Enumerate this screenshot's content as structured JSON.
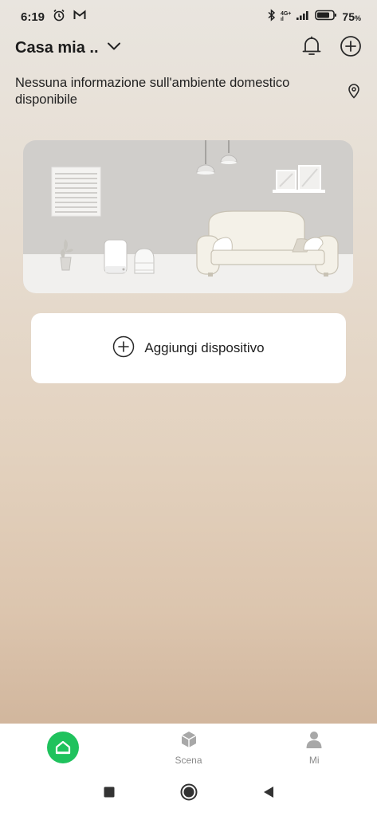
{
  "status_bar": {
    "time": "6:19",
    "network_top": "4G+",
    "network_bottom": "ıl",
    "battery": "75",
    "battery_unit": "%",
    "icons": [
      "alarm-icon",
      "gmail-icon",
      "bluetooth-icon",
      "signal-icon",
      "battery-icon"
    ]
  },
  "header": {
    "home_name": "Casa mia ..",
    "icons": [
      "chevron-down-icon",
      "bell-icon",
      "add-icon"
    ]
  },
  "environment": {
    "message": "Nessuna informazione sull'ambiente domestico disponibile",
    "icon": "location-pin-icon"
  },
  "add_device": {
    "label": "Aggiungi dispositivo",
    "icon": "add-circle-icon"
  },
  "tabs": [
    {
      "label": "",
      "icon": "home-icon",
      "active": true
    },
    {
      "label": "Scena",
      "icon": "cube-icon",
      "active": false
    },
    {
      "label": "Mi",
      "icon": "person-icon",
      "active": false
    }
  ],
  "colors": {
    "accent": "#1fc25d",
    "tab_inactive": "#8a8a8a"
  },
  "system_nav": [
    "recents-button",
    "home-button",
    "back-button"
  ]
}
